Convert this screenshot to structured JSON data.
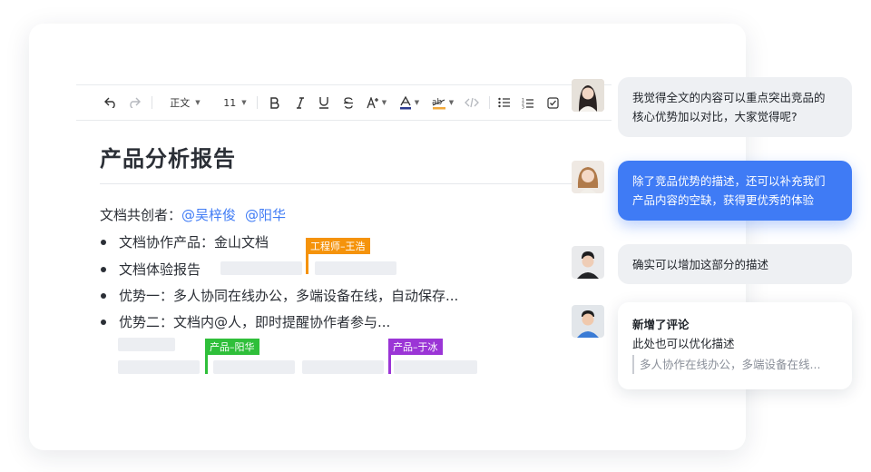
{
  "toolbar": {
    "style": "正文",
    "font_size": "11",
    "icons": [
      "undo-icon",
      "redo-icon",
      "bold-icon",
      "italic-icon",
      "underline-icon",
      "strikethrough-icon",
      "font-size-icon",
      "font-color-icon",
      "highlight-icon",
      "code-icon",
      "bullet-list-icon",
      "numbered-list-icon",
      "checkbox-icon"
    ]
  },
  "doc": {
    "title": "产品分析报告",
    "coauthors_label": "文档共创者：",
    "mentions": [
      "@吴梓俊",
      "@阳华"
    ],
    "bullets": [
      "文档协作产品：金山文档",
      "文档体验报告",
      "优势一：多人协同在线办公，多端设备在线，自动保存...",
      "优势二：文档内@人，即时提醒协作者参与..."
    ]
  },
  "cursors": [
    {
      "label": "工程师–王浩",
      "color": "#f5930b"
    },
    {
      "label": "产品–阳华",
      "color": "#2fbf3a"
    },
    {
      "label": "产品–于冰",
      "color": "#9b35d6"
    }
  ],
  "comments": [
    {
      "lines": [
        "我觉得全文的内容可以重点突出竞品的",
        "核心优势加以对比，大家觉得呢?"
      ]
    },
    {
      "lines": [
        "除了竞品优势的描述，还可以补充我们",
        "产品内容的空缺，获得更优秀的体验"
      ]
    },
    {
      "lines": [
        "确实可以增加这部分的描述"
      ]
    },
    {
      "lines": [
        "新增了评论",
        "此处也可以优化描述"
      ],
      "quote": "多人协作在线办公，多端设备在线..."
    }
  ],
  "colors": {
    "accent": "#3f7bf5",
    "text": "#1f2329"
  }
}
